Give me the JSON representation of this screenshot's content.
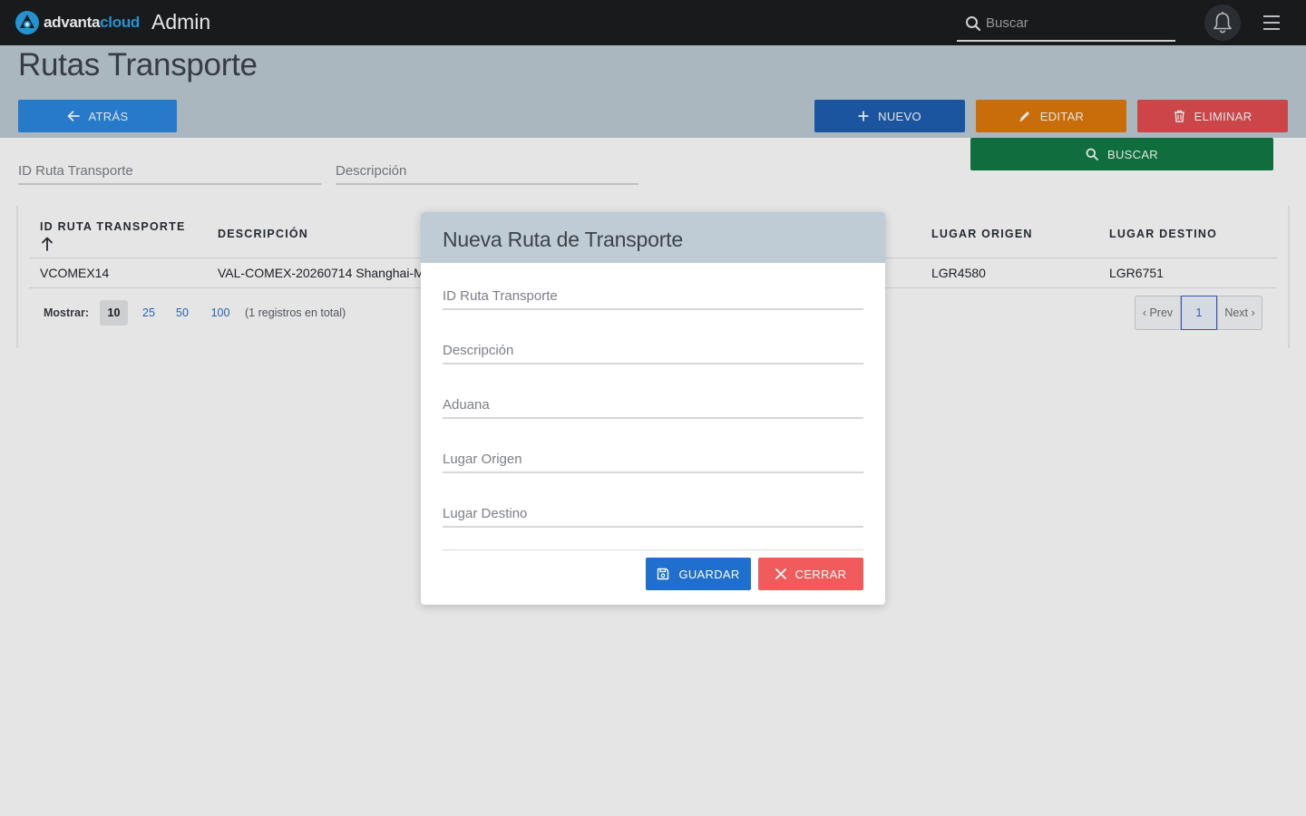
{
  "topbar": {
    "logo_text_a": "advanta",
    "logo_text_b": "cloud",
    "app_title": "Admin",
    "search_placeholder": "Buscar"
  },
  "page": {
    "title": "Rutas Transporte",
    "buttons": {
      "back": "ATRÁS",
      "new": "NUEVO",
      "edit": "EDITAR",
      "delete": "ELIMINAR",
      "search": "BUSCAR"
    },
    "filters": {
      "id_label": "ID Ruta Transporte",
      "description_label": "Descripción"
    }
  },
  "table": {
    "columns": [
      "ID RUTA TRANSPORTE",
      "DESCRIPCIÓN",
      "LUGAR ORIGEN",
      "LUGAR DESTINO"
    ],
    "sort_indicator": "↑",
    "rows": [
      {
        "id": "VCOMEX14",
        "description": "VAL-COMEX-20260714 Shanghai-M",
        "origin": "LGR4580",
        "destination": "LGR6751"
      }
    ],
    "show_label": "Mostrar:",
    "page_sizes": [
      "10",
      "25",
      "50",
      "100"
    ],
    "page_size_selected": "10",
    "total_text": "(1 registros en total)",
    "pager": {
      "prev": "‹ Prev",
      "current": "1",
      "next": "Next ›"
    }
  },
  "modal": {
    "title": "Nueva Ruta de Transporte",
    "fields": [
      "ID Ruta Transporte",
      "Descripción",
      "Aduana",
      "Lugar Origen",
      "Lugar Destino"
    ],
    "save_label": "GUARDAR",
    "close_label": "CERRAR"
  },
  "colors": {
    "topbar": "#1b1d20",
    "header": "#bfccd5",
    "back_button": "#2b88e0",
    "new_button": "#1f5fb1",
    "edit_button": "#e07a0c",
    "delete_button": "#e24d52",
    "search_button": "#127a45",
    "save_button": "#1f6fcf",
    "close_button": "#f25b5b"
  }
}
